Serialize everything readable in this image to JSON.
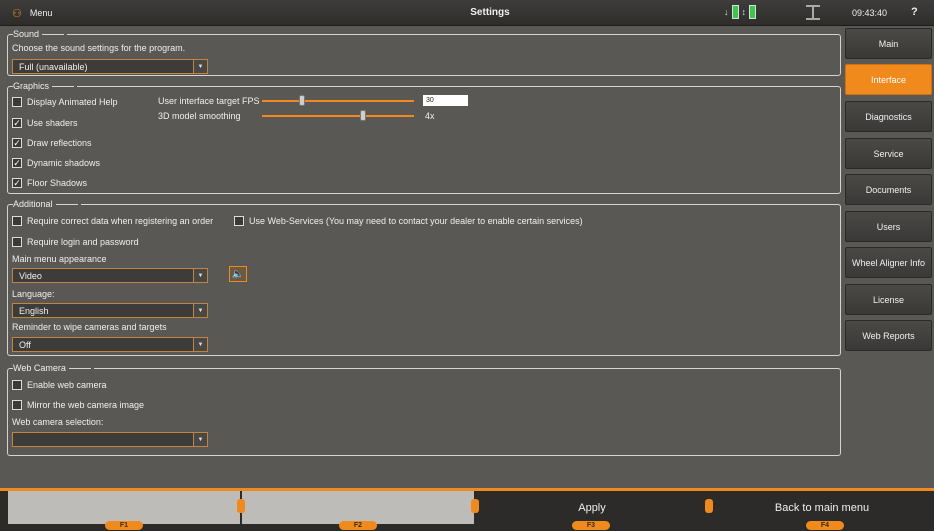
{
  "topbar": {
    "menu_label": "Menu",
    "title": "Settings",
    "clock": "09:43:40",
    "help": "?"
  },
  "sound": {
    "legend": "Sound",
    "description": "Choose the sound settings for the program.",
    "selected": "Full (unavailable)"
  },
  "graphics": {
    "legend": "Graphics",
    "display_animated_help": {
      "label": "Display Animated Help",
      "checked": false
    },
    "use_shaders": {
      "label": "Use shaders",
      "checked": true
    },
    "draw_reflections": {
      "label": "Draw reflections",
      "checked": true
    },
    "dynamic_shadows": {
      "label": "Dynamic shadows",
      "checked": true
    },
    "floor_shadows": {
      "label": "Floor Shadows",
      "checked": true
    },
    "target_fps_label": "User interface target FPS",
    "target_fps_value": "30",
    "smoothing_label": "3D model smoothing",
    "smoothing_value": "4x"
  },
  "additional": {
    "legend": "Additional",
    "require_correct_data": {
      "label": "Require correct data when registering an order",
      "checked": false
    },
    "use_web_services": {
      "label": "Use Web-Services (You may need to contact your dealer to enable certain services)",
      "checked": false
    },
    "require_login": {
      "label": "Require login and password",
      "checked": false
    },
    "main_menu_label": "Main menu appearance",
    "main_menu_value": "Video",
    "language_label": "Language:",
    "language_value": "English",
    "reminder_label": "Reminder to wipe cameras and targets",
    "reminder_value": "Off"
  },
  "webcam": {
    "legend": "Web Camera",
    "enable": {
      "label": "Enable web camera",
      "checked": false
    },
    "mirror": {
      "label": "Mirror the web camera image",
      "checked": false
    },
    "selection_label": "Web camera selection:",
    "selection_value": ""
  },
  "sidebar": {
    "items": [
      {
        "label": "Main",
        "active": false
      },
      {
        "label": "Interface",
        "active": true
      },
      {
        "label": "Diagnostics",
        "active": false
      },
      {
        "label": "Service",
        "active": false
      },
      {
        "label": "Documents",
        "active": false
      },
      {
        "label": "Users",
        "active": false
      },
      {
        "label": "Wheel Aligner Info",
        "active": false
      },
      {
        "label": "License",
        "active": false
      },
      {
        "label": "Web Reports",
        "active": false
      }
    ]
  },
  "bottombar": {
    "f1_label": "",
    "f2_label": "",
    "f3_label": "Apply",
    "f4_label": "Back to main menu",
    "f1_tag": "F1",
    "f2_tag": "F2",
    "f3_tag": "F3",
    "f4_tag": "F4"
  },
  "colors": {
    "accent": "#f08a1c",
    "background": "#5a5854",
    "battery": "#3ec64a"
  },
  "icons": [
    "menu-icon",
    "battery-icon",
    "transfer-arrow-icon",
    "lift-icon",
    "speaker-icon",
    "chevron-down-icon"
  ]
}
